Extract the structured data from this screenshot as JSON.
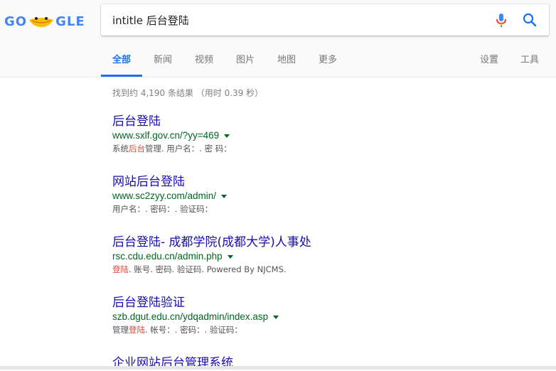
{
  "logo": {
    "text_left": "GO",
    "text_right": "GLE"
  },
  "search": {
    "query": "intitle 后台登陆"
  },
  "tabs": [
    {
      "label": "全部",
      "active": true
    },
    {
      "label": "新闻",
      "active": false
    },
    {
      "label": "视频",
      "active": false
    },
    {
      "label": "图片",
      "active": false
    },
    {
      "label": "地图",
      "active": false
    },
    {
      "label": "更多",
      "active": false
    }
  ],
  "right_tabs": [
    {
      "label": "设置"
    },
    {
      "label": "工具"
    }
  ],
  "stats": "找到约 4,190 条结果 （用时 0.39 秒）",
  "results": [
    {
      "title": "后台登陆",
      "url": "www.sxlf.gov.cn/?yy=469",
      "snippet": [
        {
          "text": "系统",
          "hl": false
        },
        {
          "text": "后台",
          "hl": true
        },
        {
          "text": "管理. 用户名：. 密 码：",
          "hl": false
        }
      ]
    },
    {
      "title": "网站后台登陆",
      "url": "www.sc2zyy.com/admin/",
      "snippet": [
        {
          "text": "用户名：. 密码：. 验证码：",
          "hl": false
        }
      ]
    },
    {
      "title": "后台登陆- 成都学院(成都大学)人事处",
      "url": "rsc.cdu.edu.cn/admin.php",
      "snippet": [
        {
          "text": "登陆",
          "hl": true
        },
        {
          "text": ". 账号. 密码. 验证码. Powered By NJCMS.",
          "hl": false
        }
      ]
    },
    {
      "title": "后台登陆验证",
      "url": "szb.dgut.edu.cn/ydqadmin/index.asp",
      "snippet": [
        {
          "text": "管理",
          "hl": false
        },
        {
          "text": "登陆",
          "hl": true
        },
        {
          "text": ". 帐号：. 密码：. 验证码：",
          "hl": false
        }
      ]
    },
    {
      "title": "企业网站后台管理系统",
      "url": "",
      "snippet": []
    }
  ],
  "colors": {
    "accent": "#1a73e8",
    "link": "#1a0dab",
    "url": "#006621",
    "highlight": "#dd4b39"
  }
}
